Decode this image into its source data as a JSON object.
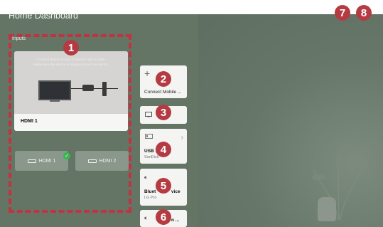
{
  "header": {
    "title": "Home Dashboard",
    "more_icon": "⋮",
    "close_icon": "✕"
  },
  "inputs": {
    "label": "Inputs",
    "card_message": "Connect device to your Projector with a cable.\nMake sure the device is plugged in and turned on.",
    "card_label": "HDMI 1",
    "buttons": [
      {
        "label": "HDMI 1",
        "selected": true
      },
      {
        "label": "HDMI 2",
        "selected": false
      }
    ]
  },
  "cards": {
    "connect_mobile": {
      "plus": "+",
      "label": "Connect Mobile ..."
    },
    "usb": {
      "label": "USB 1",
      "sub": "SanDisk"
    },
    "bluetooth": {
      "label": "Bluet",
      "label_end": "vice",
      "sub": "LG Pro"
    },
    "last": {
      "label": "n ..."
    }
  },
  "badges": [
    "1",
    "2",
    "3",
    "4",
    "5",
    "6",
    "7",
    "8"
  ],
  "colors": {
    "background": "#647566",
    "badge": "#b53b43",
    "check": "#35b84a",
    "frame": "#c23340"
  }
}
